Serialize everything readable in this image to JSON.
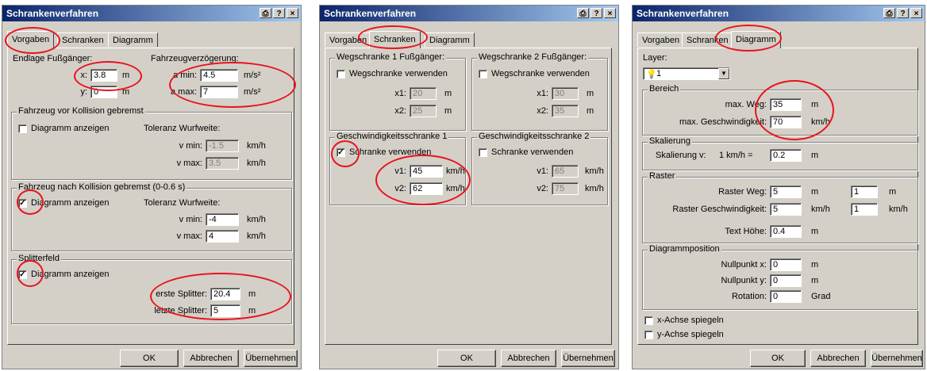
{
  "colors": {
    "titlebar": "#0a246a",
    "face": "#d4d0c8",
    "highlight_oval": "#e8131d"
  },
  "window_buttons": [
    "⎙",
    "?",
    "×"
  ],
  "w1": {
    "title": "Schrankenverfahren",
    "tabs": [
      "Vorgaben",
      "Schranken",
      "Diagramm"
    ],
    "endlage_caption": "Endlage Fußgänger:",
    "x_label": "x:",
    "x_value": "3.8",
    "x_unit": "m",
    "y_label": "y:",
    "y_value": "0",
    "y_unit": "m",
    "verz_caption": "Fahrzeugverzögerung:",
    "amin_label": "a min:",
    "amin_value": "4.5",
    "amin_unit": "m/s²",
    "amax_label": "a max:",
    "amax_value": "7",
    "amax_unit": "m/s²",
    "g1_caption": "Fahrzeug vor Kollision gebremst",
    "g1_checkbox": "Diagramm anzeigen",
    "g1_checked": "",
    "g1_tol": "Toleranz Wurfweite:",
    "g1_vmin_label": "v min:",
    "g1_vmin_value": "-1.5",
    "g1_vmin_unit": "km/h",
    "g1_vmax_label": "v max:",
    "g1_vmax_value": "3.5",
    "g1_vmax_unit": "km/h",
    "g2_caption": "Fahrzeug nach Kollision gebremst (0-0.6 s)",
    "g2_checkbox": "Diagramm anzeigen",
    "g2_checked": "✓",
    "g2_tol": "Toleranz Wurfweite:",
    "g2_vmin_label": "v min:",
    "g2_vmin_value": "-4",
    "g2_vmin_unit": "km/h",
    "g2_vmax_label": "v max:",
    "g2_vmax_value": "4",
    "g2_vmax_unit": "km/h",
    "g3_caption": "Splitterfeld",
    "g3_checkbox": "Diagramm anzeigen",
    "g3_checked": "✓",
    "erste_label": "erste Splitter:",
    "erste_value": "20.4",
    "erste_unit": "m",
    "letzte_label": "letzte Splitter:",
    "letzte_value": "5",
    "letzte_unit": "m",
    "buttons": {
      "ok": "OK",
      "cancel": "Abbrechen",
      "apply": "Übernehmen"
    }
  },
  "w2": {
    "title": "Schrankenverfahren",
    "tabs": [
      "Vorgaben",
      "Schranken",
      "Diagramm"
    ],
    "ws1_caption": "Wegschranke 1 Fußgänger:",
    "ws1_checkbox": "Wegschranke verwenden",
    "ws1_checked": "",
    "ws1_x1_label": "x1:",
    "ws1_x1_value": "20",
    "ws1_x1_unit": "m",
    "ws1_x2_label": "x2:",
    "ws1_x2_value": "25",
    "ws1_x2_unit": "m",
    "ws2_caption": "Wegschranke 2 Fußgänger:",
    "ws2_checkbox": "Wegschranke verwenden",
    "ws2_checked": "",
    "ws2_x1_label": "x1:",
    "ws2_x1_value": "30",
    "ws2_x1_unit": "m",
    "ws2_x2_label": "x2:",
    "ws2_x2_value": "35",
    "ws2_x2_unit": "m",
    "gs1_caption": "Geschwindigkeitsschranke 1",
    "gs1_checkbox": "Schranke verwenden",
    "gs1_checked": "✓",
    "gs1_v1_label": "v1:",
    "gs1_v1_value": "45",
    "gs1_v1_unit": "km/h",
    "gs1_v2_label": "v2:",
    "gs1_v2_value": "62",
    "gs1_v2_unit": "km/h",
    "gs2_caption": "Geschwindigkeitsschranke 2",
    "gs2_checkbox": "Schranke verwenden",
    "gs2_checked": "",
    "gs2_v1_label": "v1:",
    "gs2_v1_value": "65",
    "gs2_v1_unit": "km/h",
    "gs2_v2_label": "v2:",
    "gs2_v2_value": "75",
    "gs2_v2_unit": "km/h",
    "buttons": {
      "ok": "OK",
      "cancel": "Abbrechen",
      "apply": "Übernehmen"
    }
  },
  "w3": {
    "title": "Schrankenverfahren",
    "tabs": [
      "Vorgaben",
      "Schranken",
      "Diagramm"
    ],
    "layer_label": "Layer:",
    "layer_value": "1",
    "bereich_caption": "Bereich",
    "maxweg_label": "max. Weg:",
    "maxweg_value": "35",
    "maxweg_unit": "m",
    "maxgeschw_label": "max. Geschwindigkeit:",
    "maxgeschw_value": "70",
    "maxgeschw_unit": "km/h",
    "skal_caption": "Skalierung",
    "skal_label": "Skalierung v:",
    "skal_mid": "1 km/h =",
    "skal_value": "0.2",
    "skal_unit": "m",
    "raster_caption": "Raster",
    "rweg_label": "Raster Weg:",
    "rweg_value": "5",
    "rweg_unit": "m",
    "rweg_value2": "1",
    "rweg_unit2": "m",
    "rgeschw_label": "Raster Geschwindigkeit:",
    "rgeschw_value": "5",
    "rgeschw_unit": "km/h",
    "rgeschw_value2": "1",
    "rgeschw_unit2": "km/h",
    "texth_label": "Text Höhe:",
    "texth_value": "0.4",
    "texth_unit": "m",
    "dpos_caption": "Diagrammposition",
    "nx_label": "Nullpunkt x:",
    "nx_value": "0",
    "nx_unit": "m",
    "ny_label": "Nullpunkt y:",
    "ny_value": "0",
    "ny_unit": "m",
    "rot_label": "Rotation:",
    "rot_value": "0",
    "rot_unit": "Grad",
    "xachse_checkbox": "x-Achse spiegeln",
    "xachse_checked": "",
    "yachse_checkbox": "y-Achse spiegeln",
    "yachse_checked": "",
    "buttons": {
      "ok": "OK",
      "cancel": "Abbrechen",
      "apply": "Übernehmen"
    }
  }
}
